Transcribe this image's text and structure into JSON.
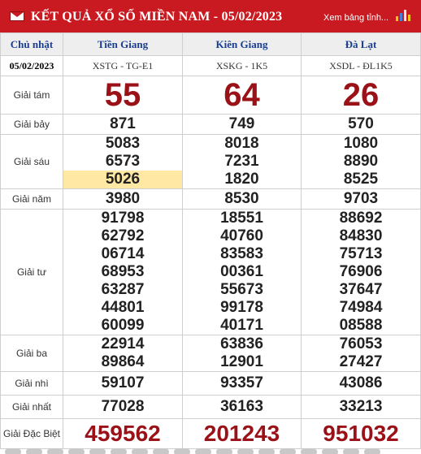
{
  "header": {
    "title": "KẾT QUẢ XỔ SỐ MIỀN NAM - 05/02/2023",
    "link_text": "Xem bảng tỉnh...",
    "icons": {
      "mail": "mail-icon",
      "chart": "bar-chart-icon"
    },
    "colors": {
      "header_bg": "#c91a21",
      "accent_number": "#9b1118",
      "highlight": "#ffe8a3"
    }
  },
  "table": {
    "day": "Chủ nhật",
    "date": "05/02/2023",
    "provinces": [
      {
        "name": "Tiền Giang",
        "code": "XSTG - TG-E1"
      },
      {
        "name": "Kiên Giang",
        "code": "XSKG - 1K5"
      },
      {
        "name": "Đà Lạt",
        "code": "XSDL - ĐL1K5"
      }
    ],
    "prizes": {
      "g8": {
        "label": "Giải tám",
        "values": [
          "55",
          "64",
          "26"
        ]
      },
      "g7": {
        "label": "Giải bảy",
        "values": [
          "871",
          "749",
          "570"
        ]
      },
      "g6": {
        "label": "Giải sáu",
        "values": [
          [
            "5083",
            "6573",
            "5026"
          ],
          [
            "8018",
            "7231",
            "1820"
          ],
          [
            "1080",
            "8890",
            "8525"
          ]
        ]
      },
      "g5": {
        "label": "Giải năm",
        "values": [
          "3980",
          "8530",
          "9703"
        ]
      },
      "g4": {
        "label": "Giải tư",
        "values": [
          [
            "91798",
            "62792",
            "06714",
            "68953",
            "63287",
            "44801",
            "60099"
          ],
          [
            "18551",
            "40760",
            "83583",
            "00361",
            "55673",
            "99178",
            "40171"
          ],
          [
            "88692",
            "84830",
            "75713",
            "76906",
            "37647",
            "74984",
            "08588"
          ]
        ]
      },
      "g3": {
        "label": "Giải ba",
        "values": [
          [
            "22914",
            "89864"
          ],
          [
            "63836",
            "12901"
          ],
          [
            "76053",
            "27427"
          ]
        ]
      },
      "g2": {
        "label": "Giải nhì",
        "values": [
          "59107",
          "93357",
          "43086"
        ]
      },
      "g1": {
        "label": "Giải nhất",
        "values": [
          "77028",
          "36163",
          "33213"
        ]
      },
      "db": {
        "label": "Giải Đặc Biệt",
        "values": [
          "459562",
          "201243",
          "951032"
        ]
      }
    }
  }
}
